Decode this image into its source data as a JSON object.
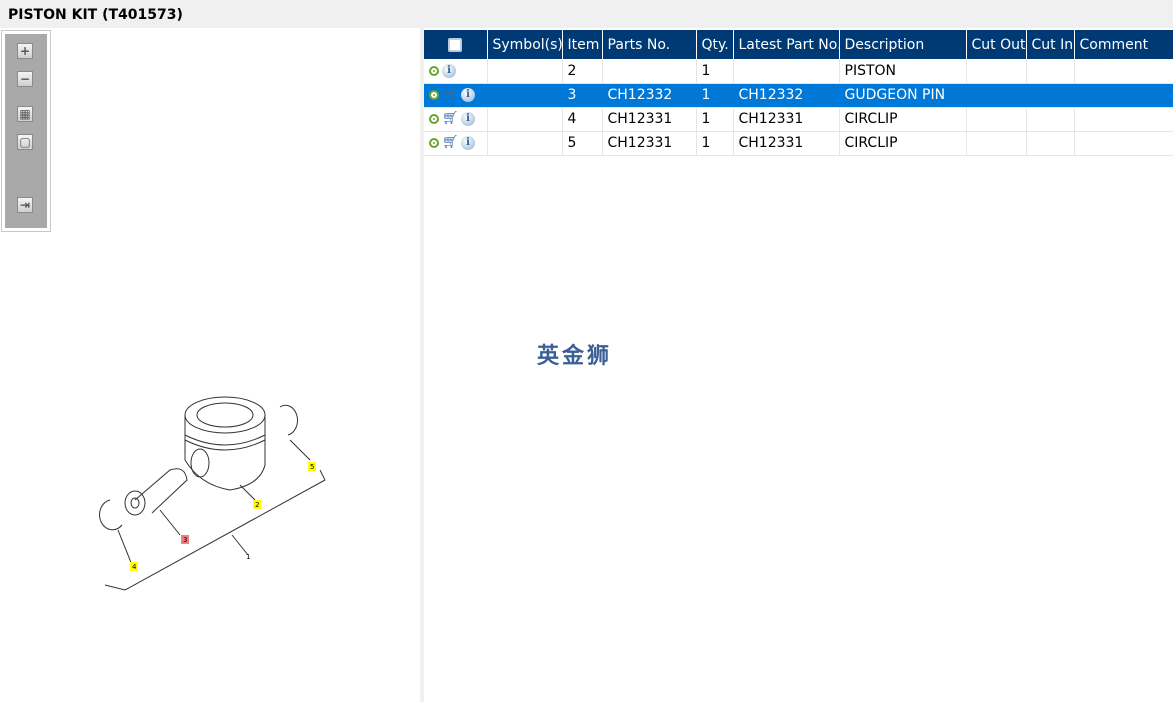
{
  "title": "PISTON KIT (T401573)",
  "toolbar": {
    "zoom_in": "+",
    "zoom_out": "−",
    "fit": "▦",
    "actual": "▢",
    "export": "⇥"
  },
  "table": {
    "headers": [
      "Symbol(s)",
      "Item",
      "Parts No.",
      "Qty.",
      "Latest Part No.",
      "Description",
      "Cut Out",
      "Cut In",
      "Comment"
    ],
    "rows": [
      {
        "cart": false,
        "item": "2",
        "part": "",
        "qty": "1",
        "latest": "",
        "desc": "PISTON",
        "selected": false
      },
      {
        "cart": true,
        "item": "3",
        "part": "CH12332",
        "qty": "1",
        "latest": "CH12332",
        "desc": "GUDGEON PIN",
        "selected": true
      },
      {
        "cart": true,
        "item": "4",
        "part": "CH12331",
        "qty": "1",
        "latest": "CH12331",
        "desc": "CIRCLIP",
        "selected": false
      },
      {
        "cart": true,
        "item": "5",
        "part": "CH12331",
        "qty": "1",
        "latest": "CH12331",
        "desc": "CIRCLIP",
        "selected": false
      }
    ]
  },
  "diagram": {
    "callouts": [
      "1",
      "2",
      "3",
      "4",
      "5"
    ]
  },
  "watermark": "英金狮",
  "colors": {
    "header": "#003a75",
    "selected": "#0078d7",
    "highlight": "#ffff00",
    "selected_callout": "#f08080"
  }
}
